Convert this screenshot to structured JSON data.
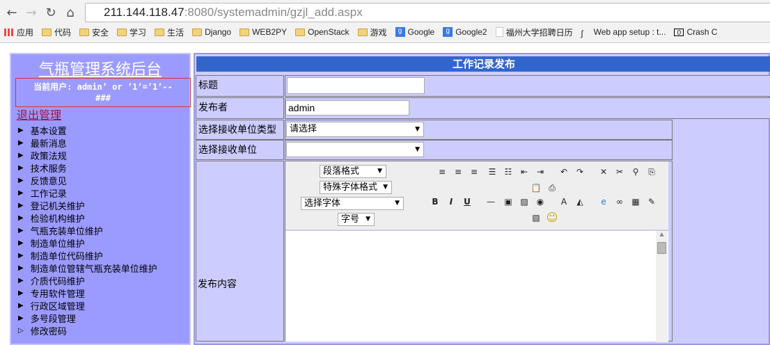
{
  "browser": {
    "url_host": "211.144.118.47",
    "url_rest": ":8080/systemadmin/gzjl_add.aspx",
    "bookmarks": [
      {
        "label": "应用",
        "icon": "apps-icon"
      },
      {
        "label": "代码",
        "icon": "folder-icon"
      },
      {
        "label": "安全",
        "icon": "folder-icon"
      },
      {
        "label": "学习",
        "icon": "folder-icon"
      },
      {
        "label": "生活",
        "icon": "folder-icon"
      },
      {
        "label": "Django",
        "icon": "folder-icon"
      },
      {
        "label": "WEB2PY",
        "icon": "folder-icon"
      },
      {
        "label": "OpenStack",
        "icon": "folder-icon"
      },
      {
        "label": "游戏",
        "icon": "folder-icon"
      },
      {
        "label": "Google",
        "icon": "google-icon"
      },
      {
        "label": "Google2",
        "icon": "google-icon"
      },
      {
        "label": "福州大学招聘日历",
        "icon": "page-icon"
      },
      {
        "label": "Web app setup : t...",
        "icon": "web-icon"
      },
      {
        "label": "Crash C",
        "icon": "crash-icon"
      }
    ]
  },
  "sidebar": {
    "title": "气瓶管理系统后台",
    "user_line1": "当前用户: admin’ or ’1’=’1’--",
    "user_line2": "###",
    "logout": "退出管理",
    "items": [
      "基本设置",
      "最新消息",
      "政策法规",
      "技术服务",
      "反馈意见",
      "工作记录",
      "登记机关维护",
      "检验机构维护",
      "气瓶充装单位维护",
      "制造单位维护",
      "制造单位代码维护",
      "制造单位管辖气瓶充装单位维护",
      "介质代码维护",
      "专用软件管理",
      "行政区域管理",
      "多号段管理",
      "修改密码"
    ]
  },
  "form": {
    "header": "工作记录发布",
    "title_label": "标题",
    "title_value": "",
    "publisher_label": "发布者",
    "publisher_value": "admin",
    "unit_type_label": "选择接收单位类型",
    "unit_type_value": "请选择",
    "unit_label": "选择接收单位",
    "unit_value": "",
    "content_label": "发布内容",
    "editor": {
      "paragraph": "段落格式",
      "special": "特殊字体格式",
      "font": "选择字体",
      "size": "字号"
    }
  },
  "colors": {
    "sidebar": "#9b9bff",
    "main": "#ccccff",
    "header": "#3366cc"
  }
}
